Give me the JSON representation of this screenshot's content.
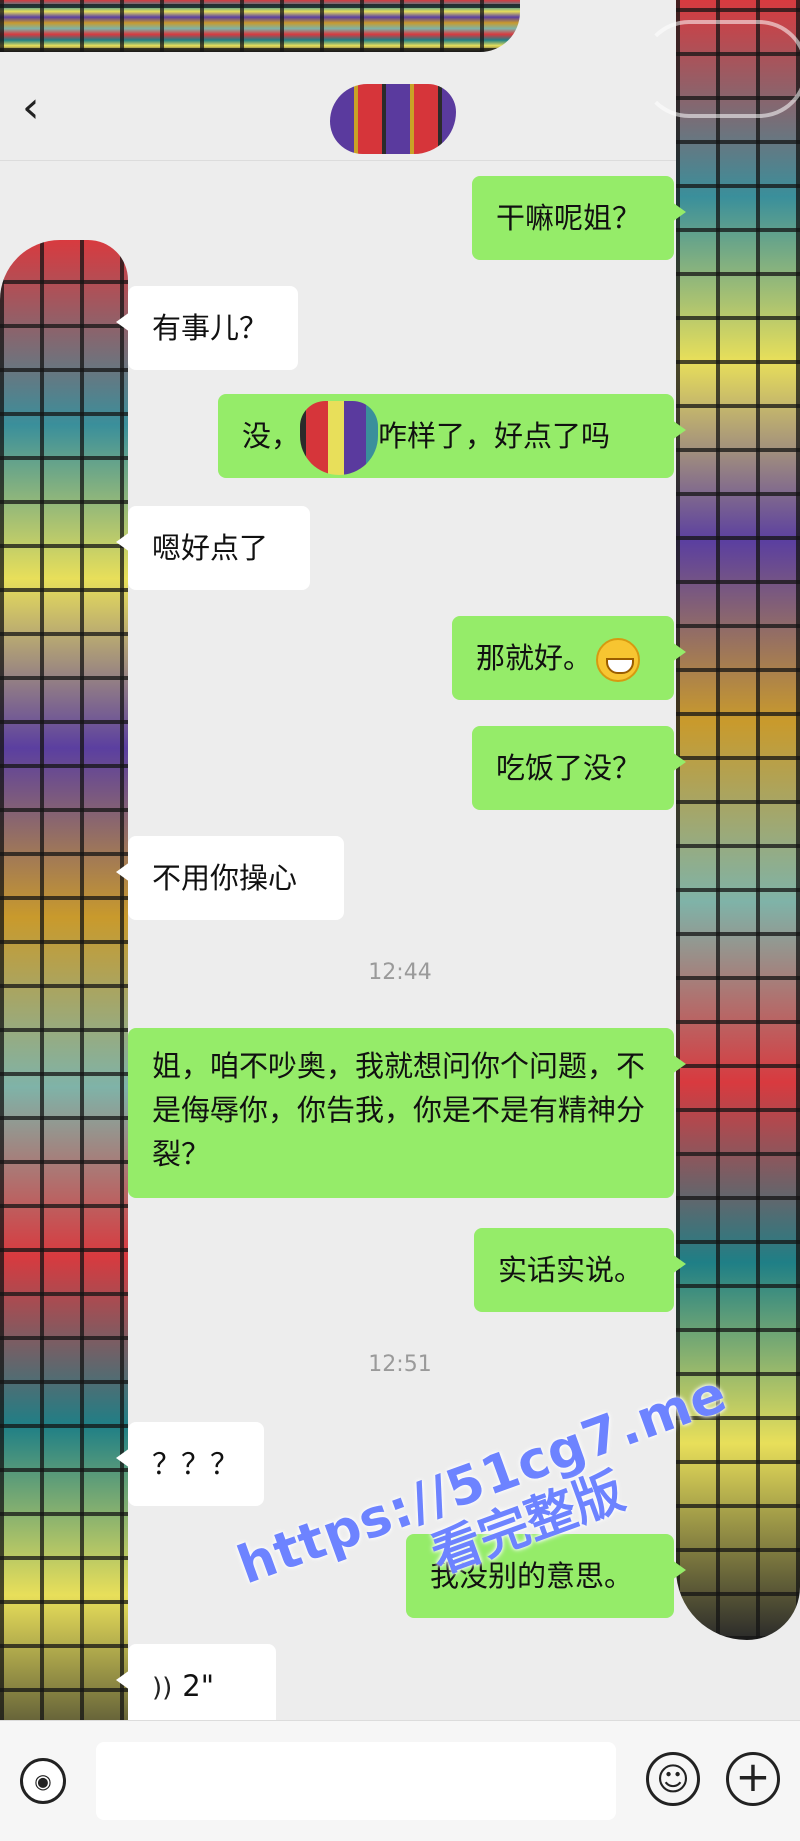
{
  "header": {
    "back_icon": "‹"
  },
  "messages": [
    {
      "side": "out",
      "text": "干嘛呢姐？"
    },
    {
      "side": "in",
      "text": "有事儿？"
    },
    {
      "side": "out",
      "before": "没，",
      "after": "咋样了，好点了吗"
    },
    {
      "side": "in",
      "text": "嗯好点了"
    },
    {
      "side": "out",
      "text": "那就好。",
      "emoji": "grin-emoji"
    },
    {
      "side": "out",
      "text": "吃饭了没？"
    },
    {
      "side": "in",
      "text": "不用你操心"
    },
    {
      "side": "out",
      "text": "姐，咱不吵奥，我就想问你个问题，不是侮辱你，你告我，你是不是有精神分裂？"
    },
    {
      "side": "out",
      "text": "实话实说。"
    },
    {
      "side": "in",
      "text": "？？？"
    },
    {
      "side": "out",
      "text": "我没别的意思。"
    },
    {
      "side": "in",
      "voice_duration": "2\""
    }
  ],
  "timestamps": [
    "12:44",
    "12:51"
  ],
  "watermark": {
    "url": "https://51cg7.me",
    "text": "看完整版"
  },
  "composer": {
    "voice_icon": "◉",
    "emoji_icon": "☺",
    "plus_icon": "+"
  },
  "colors": {
    "outgoing": "#95ec69",
    "incoming": "#ffffff",
    "background": "#ededed"
  }
}
